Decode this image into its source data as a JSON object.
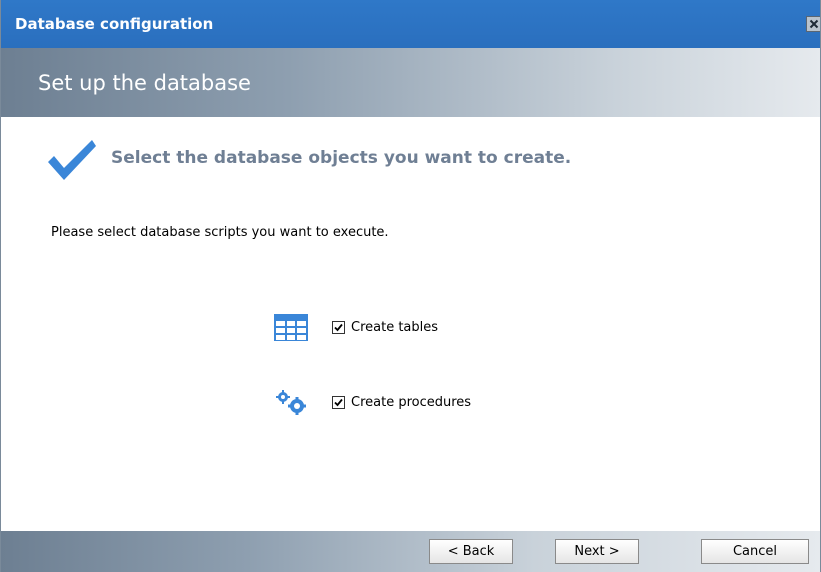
{
  "window": {
    "title": "Database configuration",
    "close_icon": "close-icon"
  },
  "header": {
    "title": "Set up the database"
  },
  "main": {
    "subtitle": "Select the database objects you want to create.",
    "instruction": "Please select database scripts you want to execute.",
    "options": [
      {
        "label": "Create tables",
        "checked": true,
        "icon": "table-icon"
      },
      {
        "label": "Create procedures",
        "checked": true,
        "icon": "gears-icon"
      }
    ]
  },
  "footer": {
    "back_label": "< Back",
    "next_label": "Next >",
    "cancel_label": "Cancel"
  },
  "colors": {
    "titlebar": "#2f78c8",
    "accent": "#3a86d8",
    "subtitle": "#6f7f94"
  }
}
